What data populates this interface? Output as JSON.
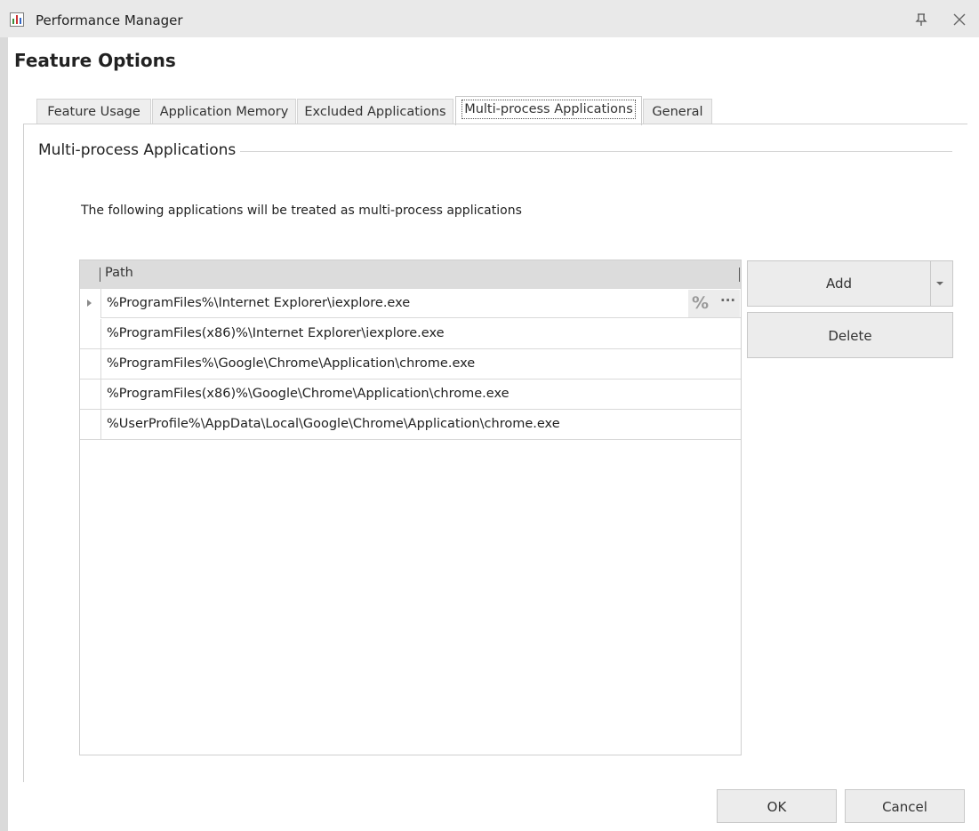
{
  "window": {
    "title": "Performance Manager",
    "icon": "chart-app-icon",
    "controls": [
      "pin-icon",
      "close-icon"
    ]
  },
  "heading": "Feature Options",
  "tabs": [
    {
      "label": "Feature Usage",
      "active": false
    },
    {
      "label": "Application Memory",
      "active": false
    },
    {
      "label": "Excluded Applications",
      "active": false
    },
    {
      "label": "Multi-process Applications",
      "active": true
    },
    {
      "label": "General",
      "active": false
    }
  ],
  "group": {
    "title": "Multi-process Applications",
    "description": "The following applications will be treated as multi-process applications"
  },
  "grid": {
    "column": "Path",
    "rows": [
      "%ProgramFiles%\\Internet Explorer\\iexplore.exe",
      "%ProgramFiles(x86)%\\Internet Explorer\\iexplore.exe",
      "%ProgramFiles%\\Google\\Chrome\\Application\\chrome.exe",
      "%ProgramFiles(x86)%\\Google\\Chrome\\Application\\chrome.exe",
      "%UserProfile%\\AppData\\Local\\Google\\Chrome\\Application\\chrome.exe"
    ],
    "editor_buttons": {
      "variable": "%",
      "browse": "···"
    }
  },
  "buttons": {
    "add": "Add",
    "delete": "Delete",
    "ok": "OK",
    "cancel": "Cancel"
  },
  "colors": {
    "titlebar": "#e9e9e9",
    "button": "#ececec",
    "grid_header": "#dcdcdc"
  }
}
